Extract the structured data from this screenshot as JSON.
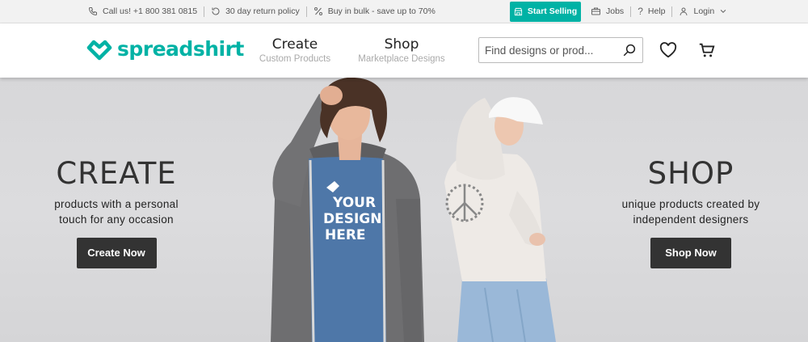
{
  "topbar": {
    "call": "Call us! +1 800 381 0815",
    "returns": "30 day return policy",
    "bulk": "Buy in bulk - save up to 70%",
    "start_selling": "Start Selling",
    "jobs": "Jobs",
    "help": "Help",
    "login": "Login"
  },
  "header": {
    "logo": "spreadshirt",
    "nav": [
      {
        "title": "Create",
        "sub": "Custom Products"
      },
      {
        "title": "Shop",
        "sub": "Marketplace Designs"
      }
    ],
    "search_placeholder": "Find designs or prod..."
  },
  "hero": {
    "left": {
      "heading": "CREATE",
      "line1": "products with a personal",
      "line2": "touch for any occasion",
      "button": "Create Now"
    },
    "right": {
      "heading": "SHOP",
      "line1": "unique products created by",
      "line2": "independent designers",
      "button": "Shop Now"
    },
    "tshirt_print": [
      "YOUR",
      "DESIGN",
      "HERE"
    ]
  },
  "colors": {
    "brand": "#00b2a5",
    "dark_button": "#333333"
  }
}
